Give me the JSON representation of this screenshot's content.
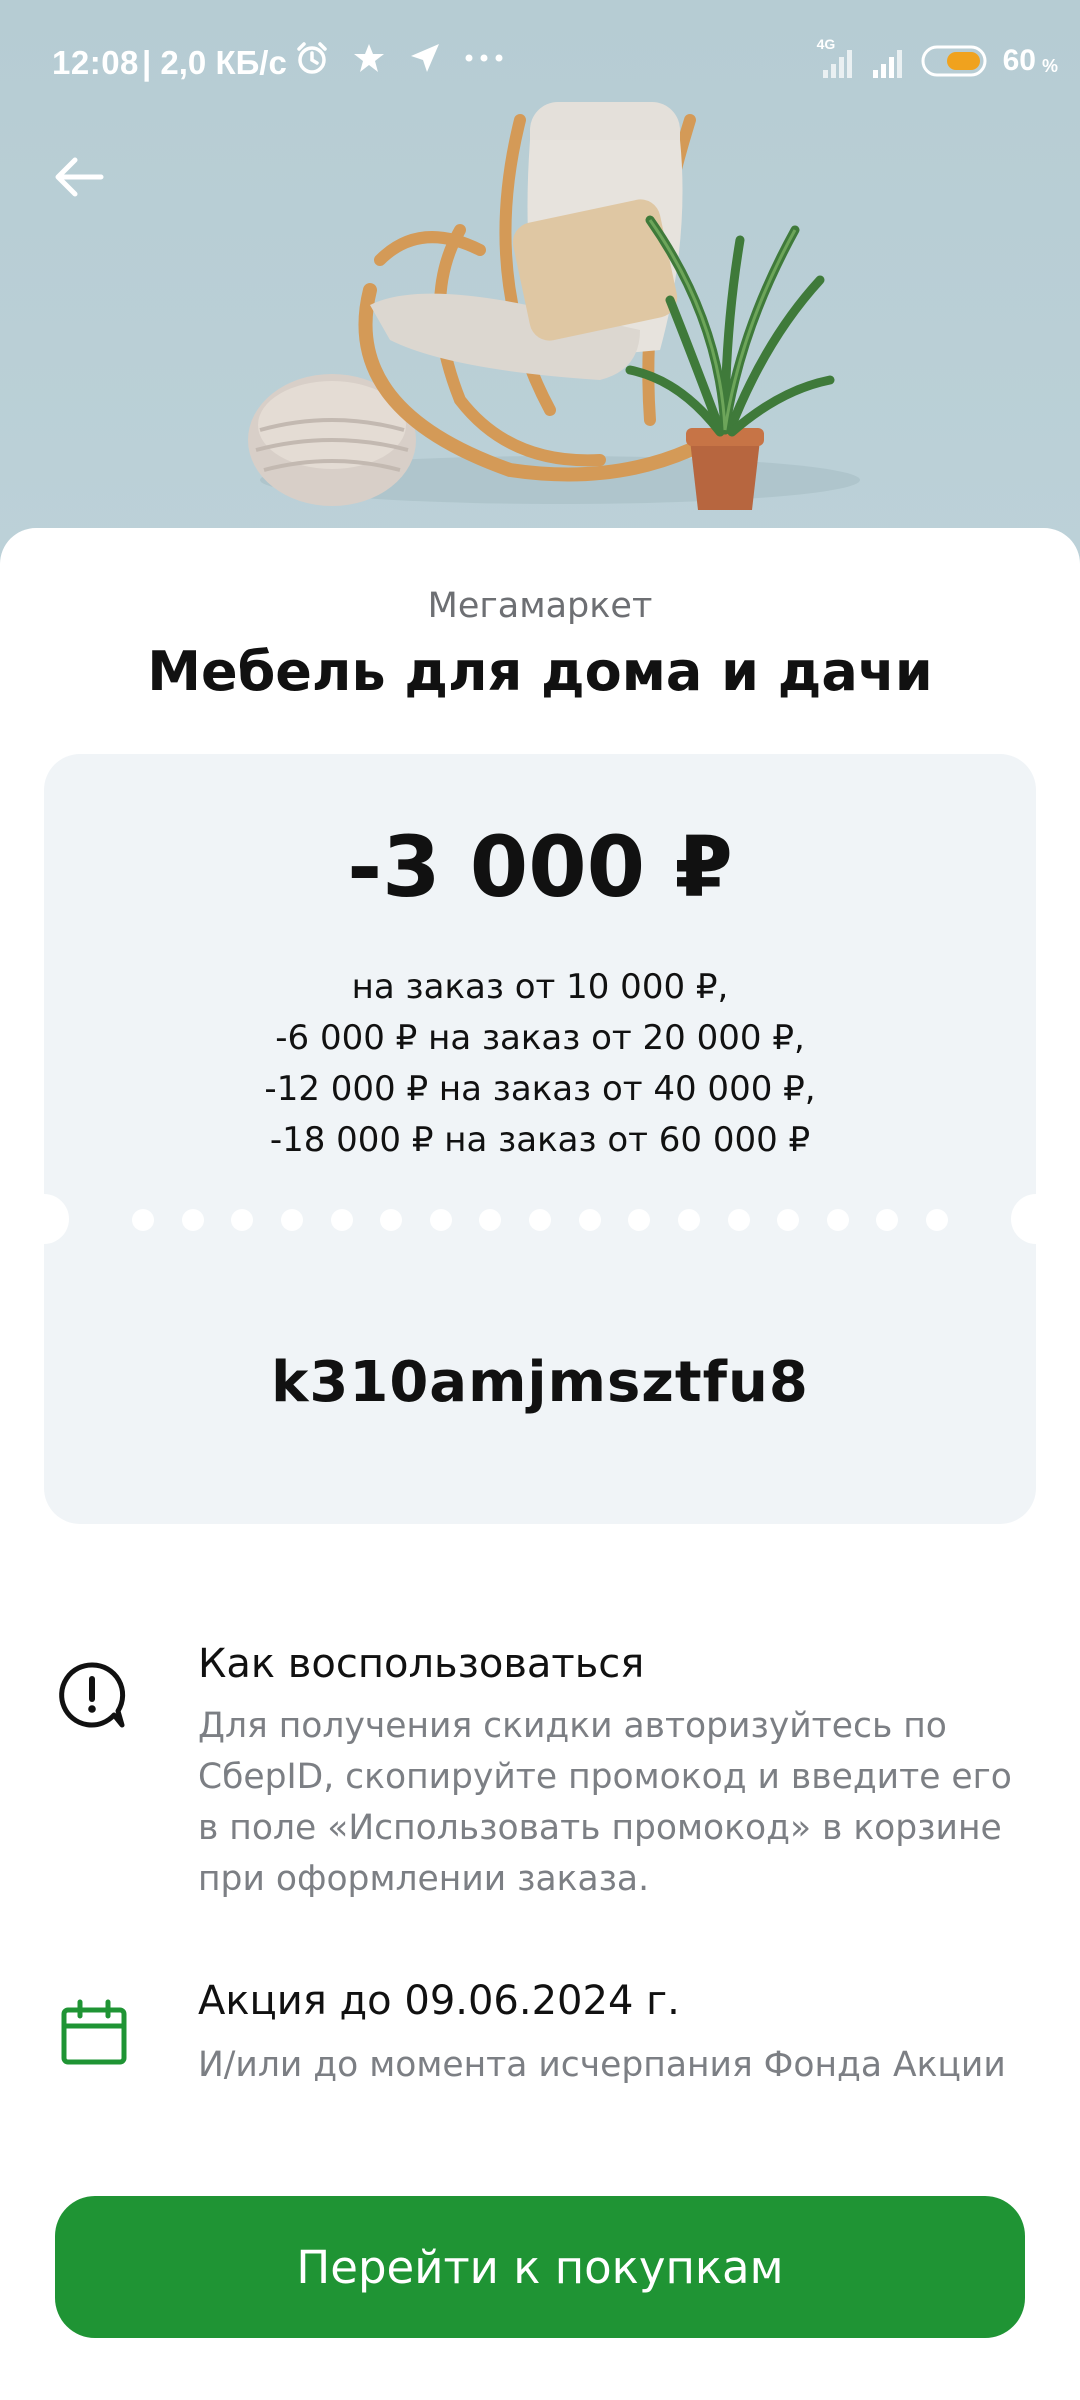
{
  "status_bar": {
    "time": "12:08",
    "speed": "| 2,0 КБ/с",
    "network": "4G",
    "battery": "60",
    "battery_unit": "%",
    "icons": [
      "alarm-icon",
      "star-icon",
      "location-arrow-icon",
      "more-dots-icon",
      "signal-icon",
      "battery-icon"
    ]
  },
  "header": {
    "back_icon": "arrow-left-icon",
    "hero_image": "rocking-chair-with-pouf-and-plant"
  },
  "offer": {
    "brand": "Мегамаркет",
    "title": "Мебель для дома и дачи",
    "discount": "-3 000 ₽",
    "conditions": [
      "на заказ от 10 000 ₽,",
      "-6 000 ₽ на заказ от 20 000 ₽,",
      "-12 000 ₽ на заказ от 40 000 ₽,",
      "-18 000 ₽ на заказ от 60 000 ₽"
    ],
    "promo_code": "k310amjmsztfu8"
  },
  "how_to_use": {
    "icon": "alert-speech-icon",
    "title": "Как воспользоваться",
    "lines": [
      "Для получения скидки авторизуйтесь по",
      "СберID, скопируйте промокод и введите его",
      "в поле «Использовать промокод» в корзине",
      "при оформлении заказа."
    ]
  },
  "period": {
    "icon": "calendar-icon",
    "title": "Акция до 09.06.2024 г.",
    "text": "И/или до момента исчерпания Фонда Акции"
  },
  "cta": {
    "label": "Перейти к покупкам"
  },
  "colors": {
    "accent_green": "#1f9434",
    "hero_bg": "#b9cfd6",
    "card_bg": "#f0f4f7"
  }
}
